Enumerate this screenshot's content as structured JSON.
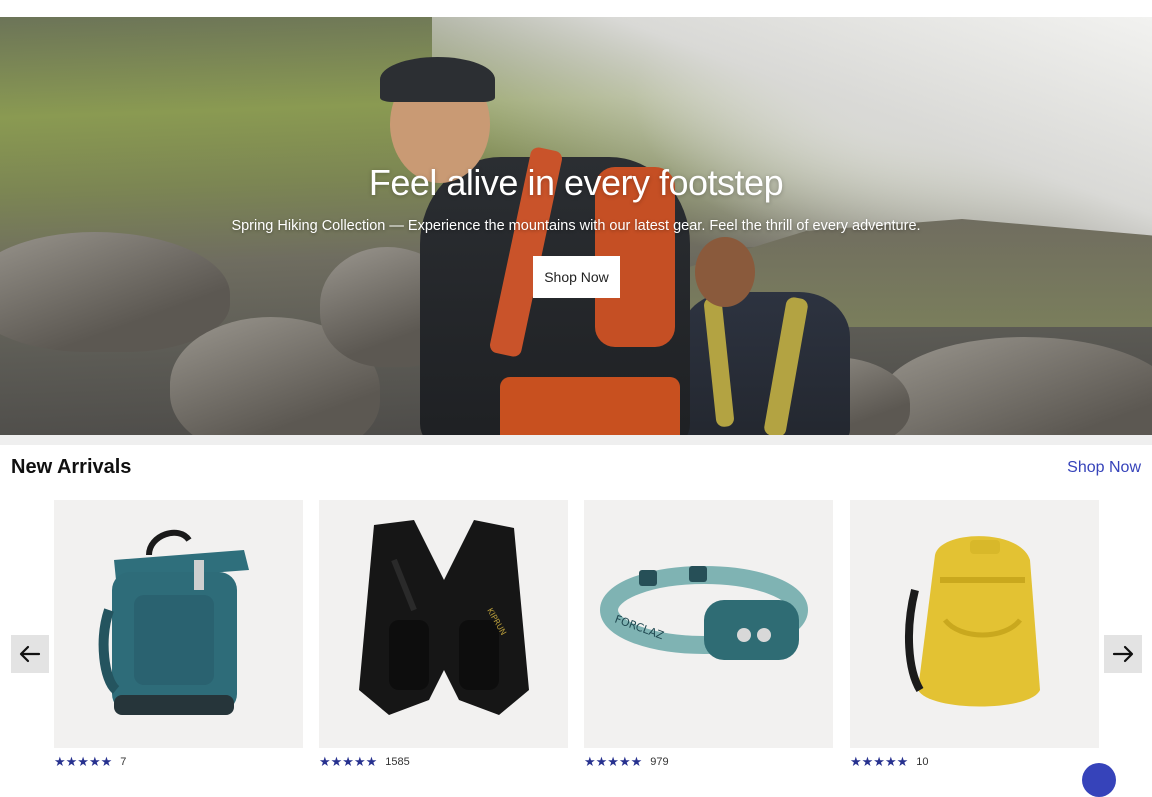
{
  "hero": {
    "title": "Feel alive in every footstep",
    "subtitle": "Spring Hiking Collection — Experience the mountains with our latest gear. Feel the thrill of every adventure.",
    "cta_label": "Shop Now"
  },
  "new_arrivals": {
    "title": "New Arrivals",
    "link_label": "Shop Now",
    "products": [
      {
        "image": "teal-rolltop-backpack",
        "stars": "★★★★★",
        "rating_value": 5.0,
        "review_count": "7"
      },
      {
        "image": "black-running-vest",
        "stars": "★★★★★",
        "rating_value": 4.5,
        "review_count": "1585"
      },
      {
        "image": "teal-headlamp",
        "stars": "★★★★★",
        "rating_value": 4.5,
        "review_count": "979"
      },
      {
        "image": "yellow-hiking-backpack",
        "stars": "★★★★★",
        "rating_value": 5.0,
        "review_count": "10"
      }
    ]
  },
  "icons": {
    "prev": "arrow-left-icon",
    "next": "arrow-right-icon"
  },
  "colors": {
    "accent": "#3643ba",
    "star": "#27318f"
  }
}
